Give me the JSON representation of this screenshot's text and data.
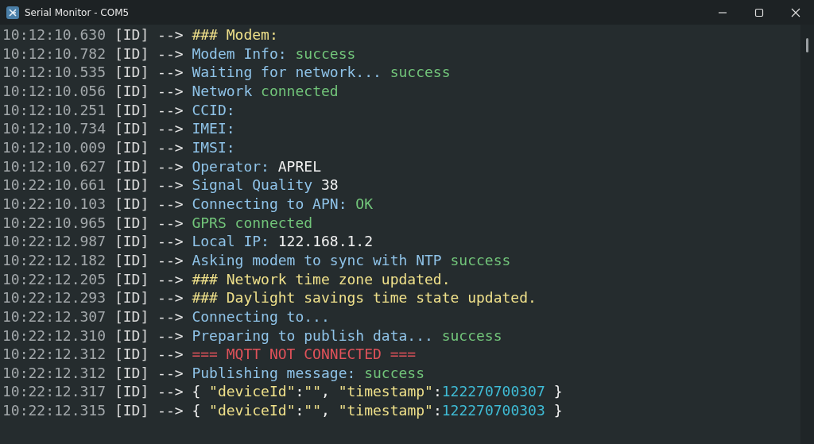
{
  "window": {
    "title": "Serial Monitor - COM5"
  },
  "log": [
    {
      "time": "10:12:10.630",
      "tag": "[ID]",
      "arrow": "-->",
      "segments": [
        {
          "text": "### Modem:",
          "kind": "heading"
        }
      ]
    },
    {
      "time": "10:12:10.782",
      "tag": "[ID]",
      "arrow": "-->",
      "segments": [
        {
          "text": "Modem Info: ",
          "kind": "label"
        },
        {
          "text": "success",
          "kind": "ok"
        }
      ]
    },
    {
      "time": "10:12:10.535",
      "tag": "[ID]",
      "arrow": "-->",
      "segments": [
        {
          "text": "Waiting for network... ",
          "kind": "label"
        },
        {
          "text": "success",
          "kind": "ok"
        }
      ]
    },
    {
      "time": "10:12:10.056",
      "tag": "[ID]",
      "arrow": "-->",
      "segments": [
        {
          "text": "Network ",
          "kind": "label"
        },
        {
          "text": "connected",
          "kind": "ok"
        }
      ]
    },
    {
      "time": "10:12:10.251",
      "tag": "[ID]",
      "arrow": "-->",
      "segments": [
        {
          "text": "CCID:",
          "kind": "label"
        }
      ]
    },
    {
      "time": "10:12:10.734",
      "tag": "[ID]",
      "arrow": "-->",
      "segments": [
        {
          "text": "IMEI:",
          "kind": "label"
        }
      ]
    },
    {
      "time": "10:12:10.009",
      "tag": "[ID]",
      "arrow": "-->",
      "segments": [
        {
          "text": "IMSI:",
          "kind": "label"
        }
      ]
    },
    {
      "time": "10:12:10.627",
      "tag": "[ID]",
      "arrow": "-->",
      "segments": [
        {
          "text": "Operator: ",
          "kind": "label"
        },
        {
          "text": "APREL",
          "kind": "value"
        }
      ]
    },
    {
      "time": "10:22:10.661",
      "tag": "[ID]",
      "arrow": "-->",
      "segments": [
        {
          "text": "Signal Quality ",
          "kind": "label"
        },
        {
          "text": "38",
          "kind": "value"
        }
      ]
    },
    {
      "time": "10:22:10.103",
      "tag": "[ID]",
      "arrow": "-->",
      "segments": [
        {
          "text": "Connecting to APN: ",
          "kind": "label"
        },
        {
          "text": "OK",
          "kind": "ok"
        }
      ]
    },
    {
      "time": "10:22:10.965",
      "tag": "[ID]",
      "arrow": "-->",
      "segments": [
        {
          "text": "GPRS connected",
          "kind": "ok"
        }
      ]
    },
    {
      "time": "10:22:12.987",
      "tag": "[ID]",
      "arrow": "-->",
      "segments": [
        {
          "text": "Local IP: ",
          "kind": "label"
        },
        {
          "text": "122.168.1.2",
          "kind": "value"
        }
      ]
    },
    {
      "time": "10:22:12.182",
      "tag": "[ID]",
      "arrow": "-->",
      "segments": [
        {
          "text": "Asking modem to sync with NTP ",
          "kind": "label"
        },
        {
          "text": "success",
          "kind": "ok"
        }
      ]
    },
    {
      "time": "10:22:12.205",
      "tag": "[ID]",
      "arrow": "-->",
      "segments": [
        {
          "text": "### Network time zone updated.",
          "kind": "heading"
        }
      ]
    },
    {
      "time": "10:22:12.293",
      "tag": "[ID]",
      "arrow": "-->",
      "segments": [
        {
          "text": "### Daylight savings time state updated.",
          "kind": "heading"
        }
      ]
    },
    {
      "time": "10:22:12.307",
      "tag": "[ID]",
      "arrow": "-->",
      "segments": [
        {
          "text": "Connecting to...",
          "kind": "label"
        }
      ]
    },
    {
      "time": "10:22:12.310",
      "tag": "[ID]",
      "arrow": "-->",
      "segments": [
        {
          "text": "Preparing to publish data... ",
          "kind": "label"
        },
        {
          "text": "success",
          "kind": "ok"
        }
      ]
    },
    {
      "time": "10:22:12.312",
      "tag": "[ID]",
      "arrow": "-->",
      "segments": [
        {
          "text": "=== MQTT NOT CONNECTED ===",
          "kind": "error"
        }
      ]
    },
    {
      "time": "10:22:12.312",
      "tag": "[ID]",
      "arrow": "-->",
      "segments": [
        {
          "text": "Publishing message: ",
          "kind": "label"
        },
        {
          "text": "success",
          "kind": "ok"
        }
      ]
    },
    {
      "time": "10:22:12.317",
      "tag": "[ID]",
      "arrow": "-->",
      "segments": [
        {
          "text": "{ ",
          "kind": "value"
        },
        {
          "text": "\"deviceId\"",
          "kind": "heading"
        },
        {
          "text": ":",
          "kind": "value"
        },
        {
          "text": "\"\"",
          "kind": "heading"
        },
        {
          "text": ", ",
          "kind": "value"
        },
        {
          "text": "\"timestamp\"",
          "kind": "heading"
        },
        {
          "text": ":",
          "kind": "value"
        },
        {
          "text": "122270700307 ",
          "kind": "number"
        },
        {
          "text": "}",
          "kind": "value"
        }
      ]
    },
    {
      "time": "10:22:12.315",
      "tag": "[ID]",
      "arrow": "-->",
      "segments": [
        {
          "text": "{ ",
          "kind": "value"
        },
        {
          "text": "\"deviceId\"",
          "kind": "heading"
        },
        {
          "text": ":",
          "kind": "value"
        },
        {
          "text": "\"\"",
          "kind": "heading"
        },
        {
          "text": ", ",
          "kind": "value"
        },
        {
          "text": "\"timestamp\"",
          "kind": "heading"
        },
        {
          "text": ":",
          "kind": "value"
        },
        {
          "text": "122270700303 ",
          "kind": "number"
        },
        {
          "text": "}",
          "kind": "value"
        }
      ]
    }
  ]
}
